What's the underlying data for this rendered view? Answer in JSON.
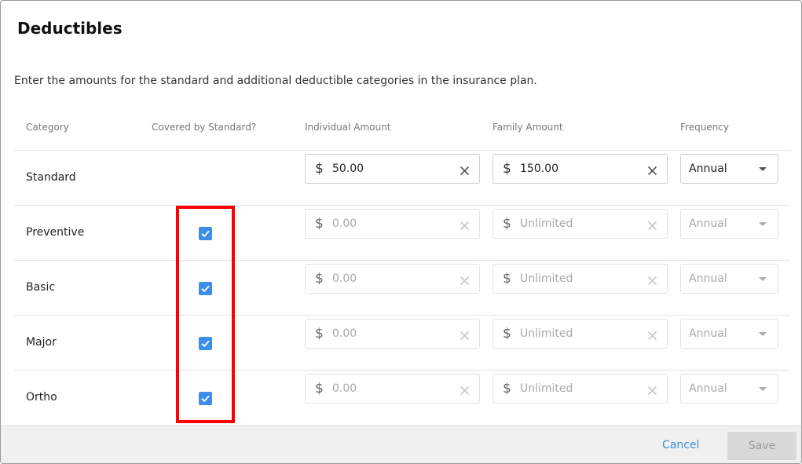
{
  "dialog": {
    "title": "Deductibles",
    "description": "Enter the amounts for the standard and additional deductible categories in the insurance plan."
  },
  "columns": {
    "category": "Category",
    "covered": "Covered by Standard?",
    "individual": "Individual Amount",
    "family": "Family Amount",
    "frequency": "Frequency"
  },
  "rows": [
    {
      "category": "Standard",
      "covered": null,
      "individual": "50.00",
      "family": "150.00",
      "frequency": "Annual",
      "disabled": false
    },
    {
      "category": "Preventive",
      "covered": true,
      "individual": "0.00",
      "family": "Unlimited",
      "frequency": "Annual",
      "disabled": true
    },
    {
      "category": "Basic",
      "covered": true,
      "individual": "0.00",
      "family": "Unlimited",
      "frequency": "Annual",
      "disabled": true
    },
    {
      "category": "Major",
      "covered": true,
      "individual": "0.00",
      "family": "Unlimited",
      "frequency": "Annual",
      "disabled": true
    },
    {
      "category": "Ortho",
      "covered": true,
      "individual": "0.00",
      "family": "Unlimited",
      "frequency": "Annual",
      "disabled": true
    }
  ],
  "currency_symbol": "$",
  "footer": {
    "cancel_label": "Cancel",
    "save_label": "Save"
  },
  "colors": {
    "accent": "#3b8ed8",
    "checkbox": "#3d8ee8",
    "highlight": "#ff0000"
  }
}
